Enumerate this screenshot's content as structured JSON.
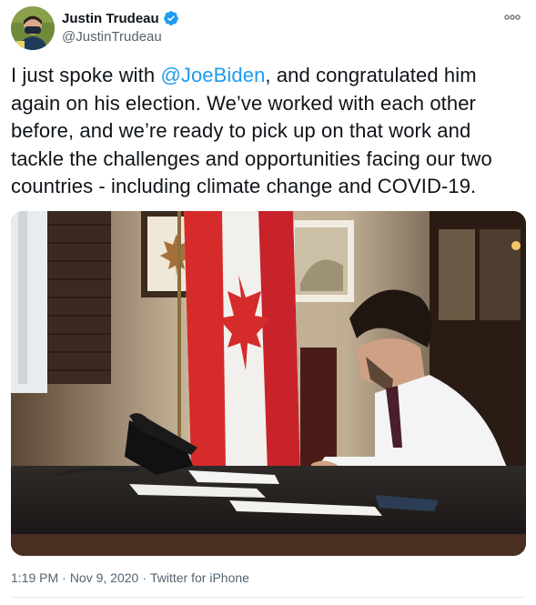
{
  "tweet": {
    "author": {
      "display_name": "Justin Trudeau",
      "handle": "@JustinTrudeau",
      "verified": true,
      "avatar_icon": "profile-photo"
    },
    "more_icon": "more-options-icon",
    "text": {
      "before_mention": "I just spoke with ",
      "mention": "@JoeBiden",
      "after_mention": ", and congratulated him again on his election. We’ve worked with each other before, and we’re ready to pick up on that work and tackle the challenges and opportunities facing our two countries - including climate change and COVID-19."
    },
    "media": {
      "type": "photo"
    },
    "meta": {
      "time": "1:19 PM",
      "separator": "·",
      "date": "Nov 9, 2020",
      "source": "Twitter for iPhone"
    },
    "colors": {
      "accent": "#1d9bf0",
      "secondary_text": "#536471",
      "primary_text": "#0f1419",
      "divider": "#e6ecf0"
    }
  }
}
